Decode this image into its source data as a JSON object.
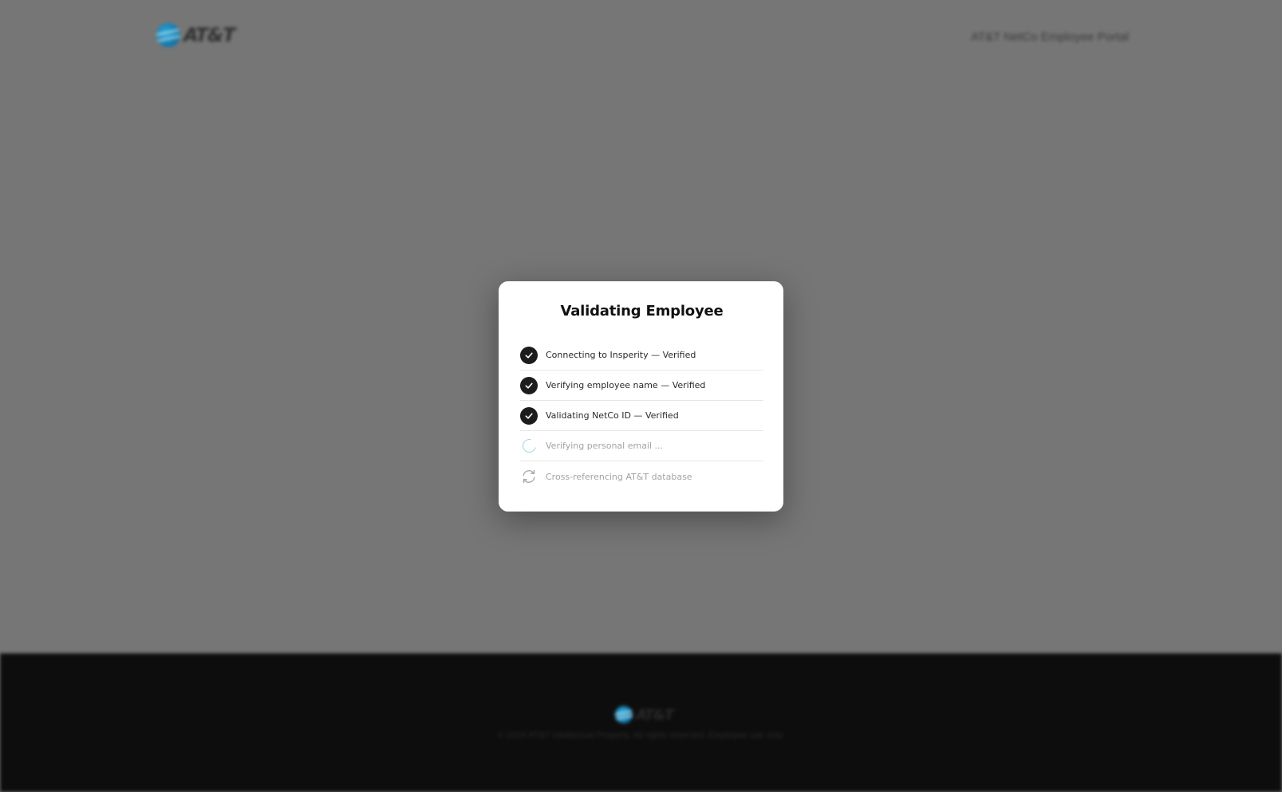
{
  "header": {
    "logo_text": "AT&T",
    "portal_title": "AT&T NetCo Employee Portal"
  },
  "footer": {
    "logo_text": "AT&T",
    "copyright": "© 2024 AT&T Intellectual Property. All rights reserved. Employee use only."
  },
  "modal": {
    "title": "Validating Employee",
    "steps": [
      {
        "label": "Connecting to Insperity — Verified",
        "status": "done",
        "icon": "check-icon"
      },
      {
        "label": "Verifying employee name — Verified",
        "status": "done",
        "icon": "check-icon"
      },
      {
        "label": "Validating NetCo ID — Verified",
        "status": "done",
        "icon": "check-icon"
      },
      {
        "label": "Verifying personal email ...",
        "status": "in-progress",
        "icon": "spinner-icon"
      },
      {
        "label": "Cross-referencing AT&T database",
        "status": "pending",
        "icon": "refresh-icon"
      }
    ]
  },
  "colors": {
    "overlay": "#767676",
    "footer": "#0d0d0d",
    "check_circle": "#1c1c1e",
    "spinner": "#9fd3e0",
    "brand": "#0d72a6"
  }
}
